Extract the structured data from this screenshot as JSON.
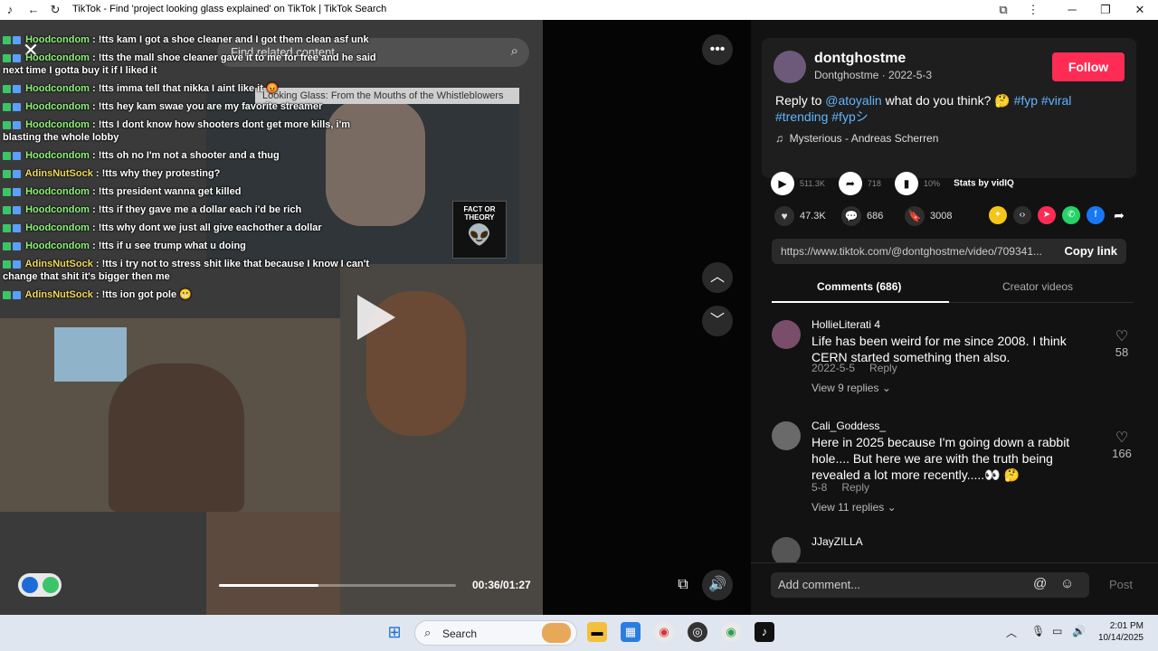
{
  "window": {
    "title": "TikTok - Find 'project looking glass explained' on TikTok | TikTok Search"
  },
  "video": {
    "search_placeholder": "Find related content",
    "inset_caption": "Looking Glass: From the Mouths of the Whistleblowers",
    "inset_badge": "FACT OR THEORY",
    "time": "00:36/01:27",
    "progress": 0.42
  },
  "chat": [
    {
      "user": "Hoodcondom",
      "msg": ": !tts kam I got a shoe cleaner and I got them clean asf unk",
      "color": "#8ff27a"
    },
    {
      "user": "Hoodcondom",
      "msg": ": !tts the mall shoe cleaner gave it to me for free and he said next time I gotta buy it if I liked it",
      "color": "#8ff27a"
    },
    {
      "user": "Hoodcondom",
      "msg": ": !tts imma tell that nikka I aint like it 😡",
      "color": "#8ff27a"
    },
    {
      "user": "Hoodcondom",
      "msg": ": !tts hey kam swae you are my favorite streamer",
      "color": "#8ff27a"
    },
    {
      "user": "Hoodcondom",
      "msg": ": !tts I dont know how shooters dont get more kills, i'm blasting the whole lobby",
      "color": "#8ff27a"
    },
    {
      "user": "Hoodcondom",
      "msg": ": !tts oh no I'm not a shooter and a thug",
      "color": "#8ff27a"
    },
    {
      "user": "AdinsNutSock",
      "msg": ": !tts why they protesting?",
      "color": "#f0d95a"
    },
    {
      "user": "Hoodcondom",
      "msg": ": !tts president wanna get killed",
      "color": "#8ff27a"
    },
    {
      "user": "Hoodcondom",
      "msg": ": !tts if they gave me a dollar each i'd be rich",
      "color": "#8ff27a"
    },
    {
      "user": "Hoodcondom",
      "msg": ": !tts why dont we just all give eachother a dollar",
      "color": "#8ff27a"
    },
    {
      "user": "Hoodcondom",
      "msg": ": !tts if u see trump what u doing",
      "color": "#8ff27a"
    },
    {
      "user": "AdinsNutSock",
      "msg": ": !tts i try not to stress shit like that because I know I can't change that shit it's bigger then me",
      "color": "#f0d95a"
    },
    {
      "user": "AdinsNutSock",
      "msg": ": !tts ion got pole 😬",
      "color": "#f0d95a"
    }
  ],
  "post": {
    "username": "dontghostme",
    "subtitle": "Dontghostme · 2022-5-3",
    "follow_label": "Follow",
    "desc_prefix": "Reply to ",
    "mention": "@atoyalin",
    "desc_mid": " what do you think? 🤔 ",
    "tags": "#fyp #viral #trending #fypシ",
    "music": "Mysterious - Andreas Scherren",
    "plays": "511.3K",
    "shares": "718",
    "engagement": "10%",
    "stats_label": "Stats by vidIQ",
    "likes": "47.3K",
    "comments": "686",
    "saves": "3008",
    "url": "https://www.tiktok.com/@dontghostme/video/709341...",
    "copy_label": "Copy link"
  },
  "tabs": {
    "comments": "Comments (686)",
    "creator": "Creator videos"
  },
  "comments": [
    {
      "name": "HollieLiterati 4",
      "text": "Life has been weird for me since 2008. I think CERN started something then also.",
      "date": "2022-5-5",
      "reply": "Reply",
      "likes": "58",
      "views": "View 9 replies"
    },
    {
      "name": "Cali_Goddess_",
      "text": "Here in 2025 because I'm going down a rabbit hole.... But here we are with the truth being revealed a lot more recently.....👀 🤔",
      "date": "5-8",
      "reply": "Reply",
      "likes": "166",
      "views": "View 11 replies"
    },
    {
      "name": "JJayZILLA",
      "text": "",
      "date": "",
      "reply": "",
      "likes": "",
      "views": ""
    }
  ],
  "comment_bar": {
    "placeholder": "Add comment...",
    "post_label": "Post"
  },
  "taskbar": {
    "search_label": "Search",
    "time": "2:01 PM",
    "date": "10/14/2025"
  }
}
